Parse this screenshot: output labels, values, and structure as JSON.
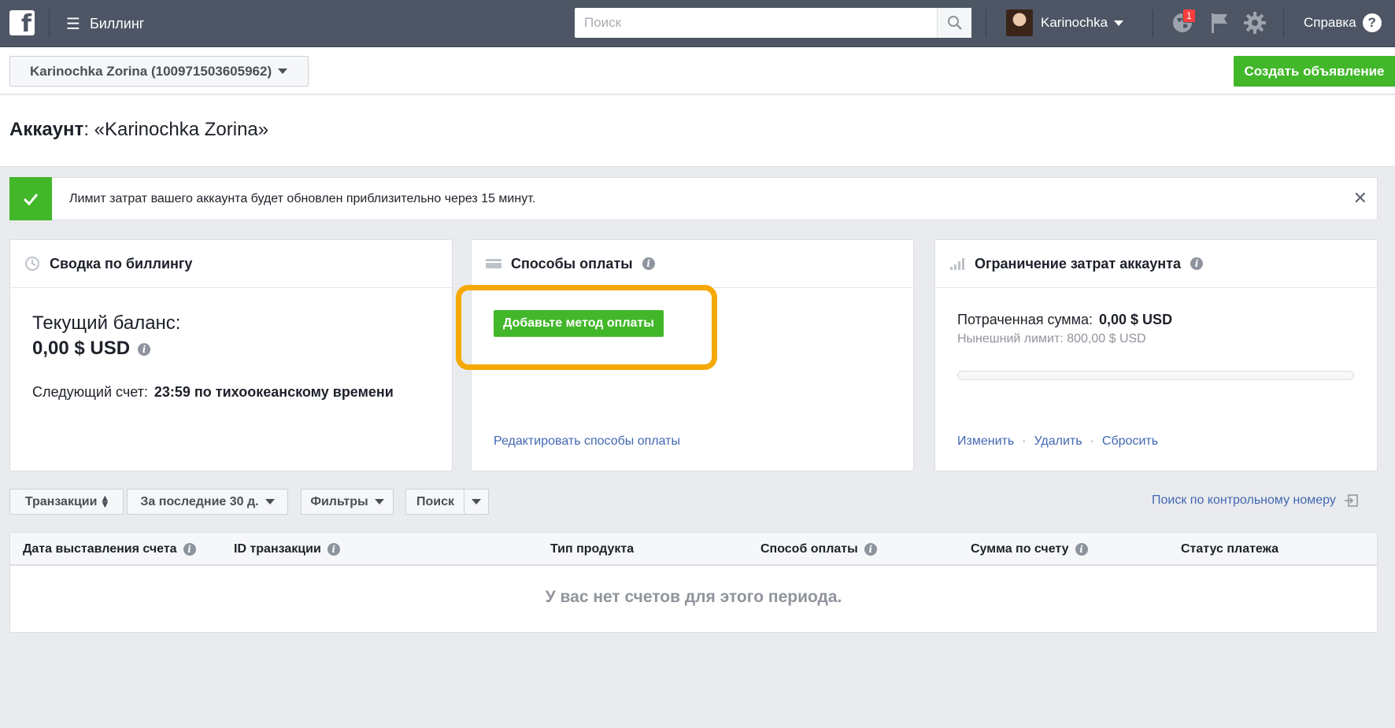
{
  "topbar": {
    "section_title": "Биллинг",
    "search_placeholder": "Поиск",
    "user_name": "Karinochka",
    "notification_count": "1",
    "help_label": "Справка"
  },
  "subbar": {
    "account_selector": "Karinochka Zorina (100971503605962)",
    "create_ad_label": "Создать объявление"
  },
  "page": {
    "title_prefix": "Аккаунт",
    "title_name": ": «Karinochka Zorina»"
  },
  "alert": {
    "message": "Лимит затрат вашего аккаунта будет обновлен приблизительно через 15 минут."
  },
  "billing_summary": {
    "title": "Сводка по биллингу",
    "balance_label": "Текущий баланс:",
    "balance_value": "0,00 $ USD",
    "next_bill_label": "Следующий счет:",
    "next_bill_value": "23:59 по тихоокеанскому времени"
  },
  "payment_methods": {
    "title": "Способы оплаты",
    "add_button": "Добавьте метод оплаты",
    "edit_link": "Редактировать способы оплаты"
  },
  "spend_limit": {
    "title": "Ограничение затрат аккаунта",
    "spent_label": "Потраченная сумма:",
    "spent_value": "0,00 $ USD",
    "current_limit": "Нынешний лимит: 800,00 $ USD",
    "progress_fraction": 0,
    "actions": [
      "Изменить",
      "Удалить",
      "Сбросить"
    ]
  },
  "filters": {
    "transactions": "Транзакции",
    "period": "За последние 30 д.",
    "filters": "Фильтры",
    "search": "Поиск",
    "search_by_number": "Поиск по контрольному номеру"
  },
  "table": {
    "columns": [
      "Дата выставления счета",
      "ID транзакции",
      "Тип продукта",
      "Способ оплаты",
      "Сумма по счету",
      "Статус платежа"
    ],
    "empty_message": "У вас нет счетов для этого периода."
  },
  "colors": {
    "topbar": "#4e5665",
    "accent_green": "#42b72a",
    "link_blue": "#4267b2",
    "highlight_orange": "#f5a800"
  }
}
